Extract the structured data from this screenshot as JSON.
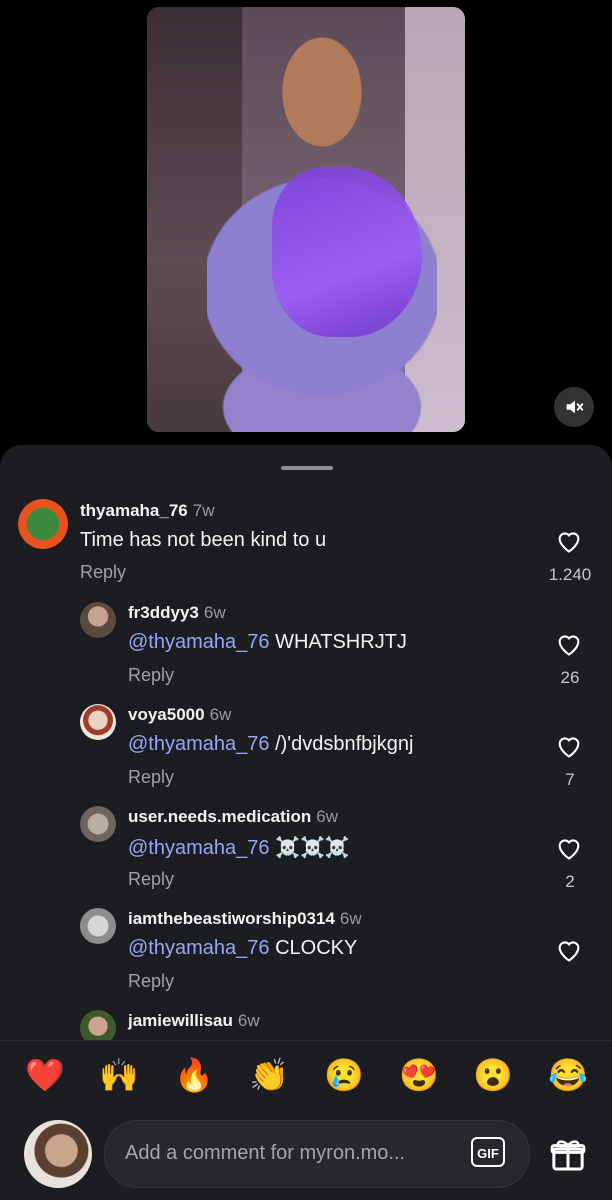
{
  "video": {
    "mute_icon": "speaker-muted-icon"
  },
  "comments": [
    {
      "username": "thyamaha_76",
      "time": "7w",
      "text": "Time has not been kind to u",
      "reply": "Reply",
      "likes": "1.240"
    },
    {
      "username": "fr3ddyy3",
      "time": "6w",
      "mention": "@thyamaha_76",
      "text": " WHATSHRJTJ",
      "reply": "Reply",
      "likes": "26"
    },
    {
      "username": "voya5000",
      "time": "6w",
      "mention": "@thyamaha_76",
      "text": " /)'dvdsbnfbjkgnj",
      "reply": "Reply",
      "likes": "7"
    },
    {
      "username": "user.needs.medication",
      "time": "6w",
      "mention": "@thyamaha_76",
      "text": " ☠️☠️☠️",
      "reply": "Reply",
      "likes": "2"
    },
    {
      "username": "iamthebeastiworship0314",
      "time": "6w",
      "mention": "@thyamaha_76",
      "text": " CLOCKY",
      "reply": "Reply",
      "likes": ""
    },
    {
      "username": "jamiewillisau",
      "time": "6w"
    }
  ],
  "reactions": [
    "❤️",
    "🙌",
    "🔥",
    "👏",
    "😢",
    "😍",
    "😮",
    "😂"
  ],
  "composer": {
    "placeholder": "Add a comment for myron.mo...",
    "gif_label": "GIF"
  }
}
